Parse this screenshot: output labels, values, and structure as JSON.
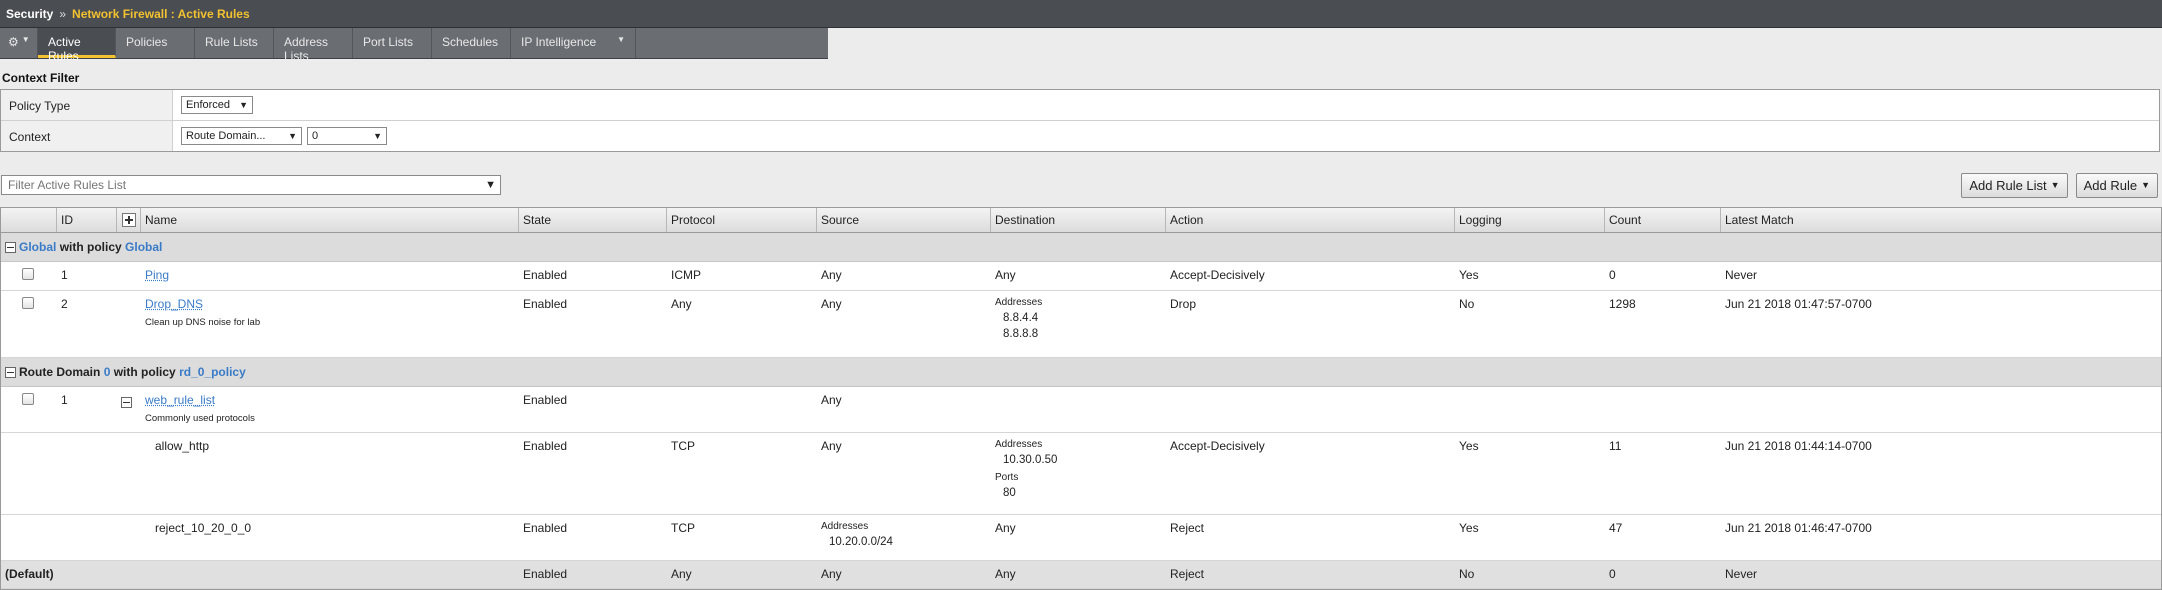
{
  "breadcrumb": {
    "section": "Security",
    "separator": "»",
    "page": "Network Firewall : Active Rules"
  },
  "tabs": [
    {
      "label": "Active Rules",
      "active": true
    },
    {
      "label": "Policies"
    },
    {
      "label": "Rule Lists"
    },
    {
      "label": "Address Lists"
    },
    {
      "label": "Port Lists"
    },
    {
      "label": "Schedules"
    },
    {
      "label": "IP Intelligence"
    }
  ],
  "context_filter": {
    "title": "Context Filter",
    "policy_type_label": "Policy Type",
    "policy_type_value": "Enforced",
    "context_label": "Context",
    "context_value": "Route Domain...",
    "context_id": "0"
  },
  "filter": {
    "placeholder": "Filter Active Rules List"
  },
  "buttons": {
    "add_rule_list": "Add Rule List",
    "add_rule": "Add Rule"
  },
  "columns": [
    "ID",
    "Name",
    "State",
    "Protocol",
    "Source",
    "Destination",
    "Action",
    "Logging",
    "Count",
    "Latest Match"
  ],
  "groups": {
    "global": {
      "name": "Global",
      "with": "with policy",
      "policy": "Global"
    },
    "rd": {
      "prefix": "Route Domain",
      "id": "0",
      "with": "with policy",
      "policy": "rd_0_policy"
    }
  },
  "rows": {
    "ping": {
      "id": "1",
      "name": "Ping",
      "state": "Enabled",
      "protocol": "ICMP",
      "source": "Any",
      "destination": "Any",
      "action": "Accept-Decisively",
      "logging": "Yes",
      "count": "0",
      "latest": "Never"
    },
    "dns": {
      "id": "2",
      "name": "Drop_DNS",
      "desc": "Clean up DNS noise for lab",
      "state": "Enabled",
      "protocol": "Any",
      "source": "Any",
      "dest_header": "Addresses",
      "dest_a": "8.8.4.4",
      "dest_b": "8.8.8.8",
      "action": "Drop",
      "logging": "No",
      "count": "1298",
      "latest": "Jun 21 2018 01:47:57-0700"
    },
    "web": {
      "id": "1",
      "name": "web_rule_list",
      "desc": "Commonly used protocols",
      "state": "Enabled",
      "source": "Any"
    },
    "http": {
      "name": "allow_http",
      "state": "Enabled",
      "protocol": "TCP",
      "source": "Any",
      "dest_header": "Addresses",
      "dest_addr": "10.30.0.50",
      "ports_header": "Ports",
      "port": "80",
      "action": "Accept-Decisively",
      "logging": "Yes",
      "count": "11",
      "latest": "Jun 21 2018 01:44:14-0700"
    },
    "reject": {
      "name": "reject_10_20_0_0",
      "state": "Enabled",
      "protocol": "TCP",
      "src_header": "Addresses",
      "src_addr": "10.20.0.0/24",
      "destination": "Any",
      "action": "Reject",
      "logging": "Yes",
      "count": "47",
      "latest": "Jun 21 2018 01:46:47-0700"
    },
    "default": {
      "name": "(Default)",
      "state": "Enabled",
      "protocol": "Any",
      "source": "Any",
      "destination": "Any",
      "action": "Reject",
      "logging": "No",
      "count": "0",
      "latest": "Never"
    }
  }
}
